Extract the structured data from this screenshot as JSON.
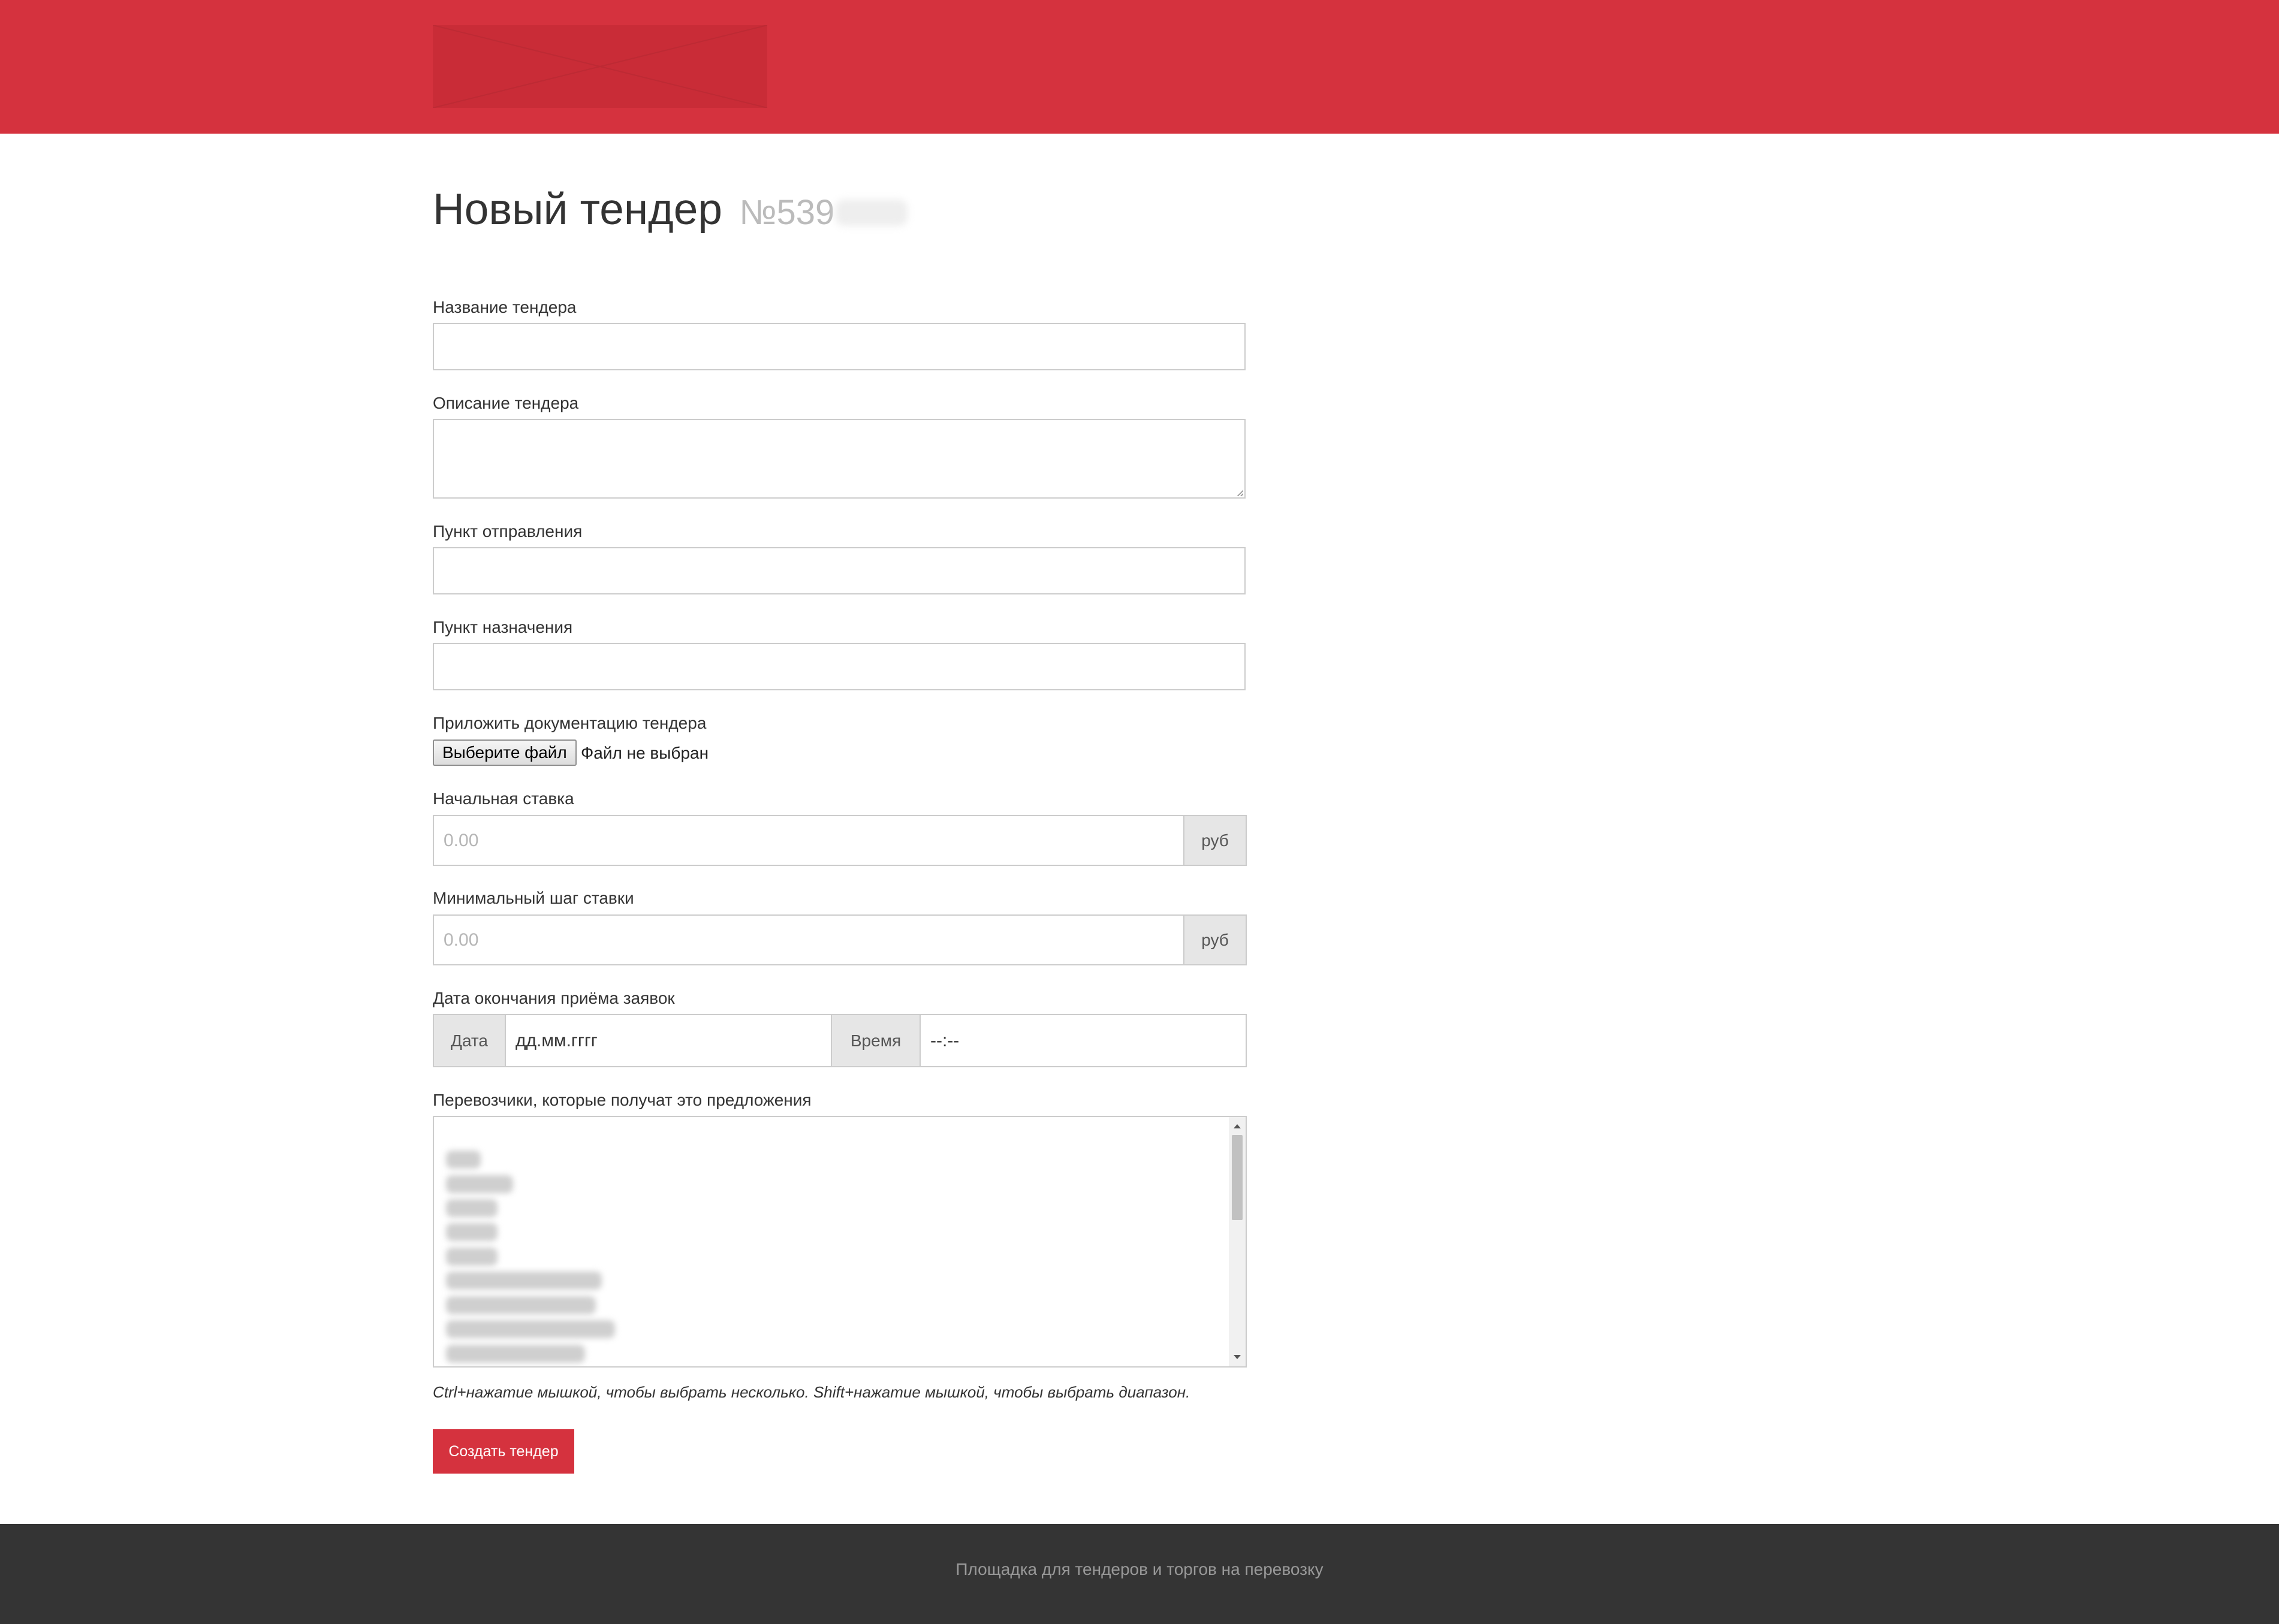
{
  "header": {
    "logo_icon": "broken-image-placeholder"
  },
  "page": {
    "title": "Новый тендер",
    "number": "№539"
  },
  "form": {
    "tender_name": {
      "label": "Название тендера",
      "value": ""
    },
    "tender_description": {
      "label": "Описание тендера",
      "value": ""
    },
    "departure_point": {
      "label": "Пункт отправления",
      "value": ""
    },
    "destination_point": {
      "label": "Пункт назначения",
      "value": ""
    },
    "documentation": {
      "label": "Приложить документацию тендера",
      "button_label": "Выберите файл",
      "status": "Файл не выбран"
    },
    "starting_bid": {
      "label": "Начальная ставка",
      "placeholder": "0.00",
      "unit": "руб"
    },
    "min_bid_step": {
      "label": "Минимальный шаг ставки",
      "placeholder": "0.00",
      "unit": "руб"
    },
    "deadline": {
      "label": "Дата окончания приёма заявок",
      "date_addon": "Дата",
      "date_value": "дд.мм.гггг",
      "time_addon": "Время",
      "time_value": "--:--"
    },
    "carriers": {
      "label": "Перевозчики, которые получат это предложения",
      "options": [
        "",
        "",
        "",
        "",
        "",
        "",
        "",
        "",
        ""
      ],
      "hint": "Ctrl+нажатие мышкой, чтобы выбрать несколько. Shift+нажатие мышкой, чтобы выбрать диапазон."
    },
    "submit_label": "Создать тендер"
  },
  "footer": {
    "text": "Площадка для тендеров и торгов на перевозку"
  },
  "colors": {
    "brand": "#d5323e",
    "footer_bg": "#343434"
  }
}
